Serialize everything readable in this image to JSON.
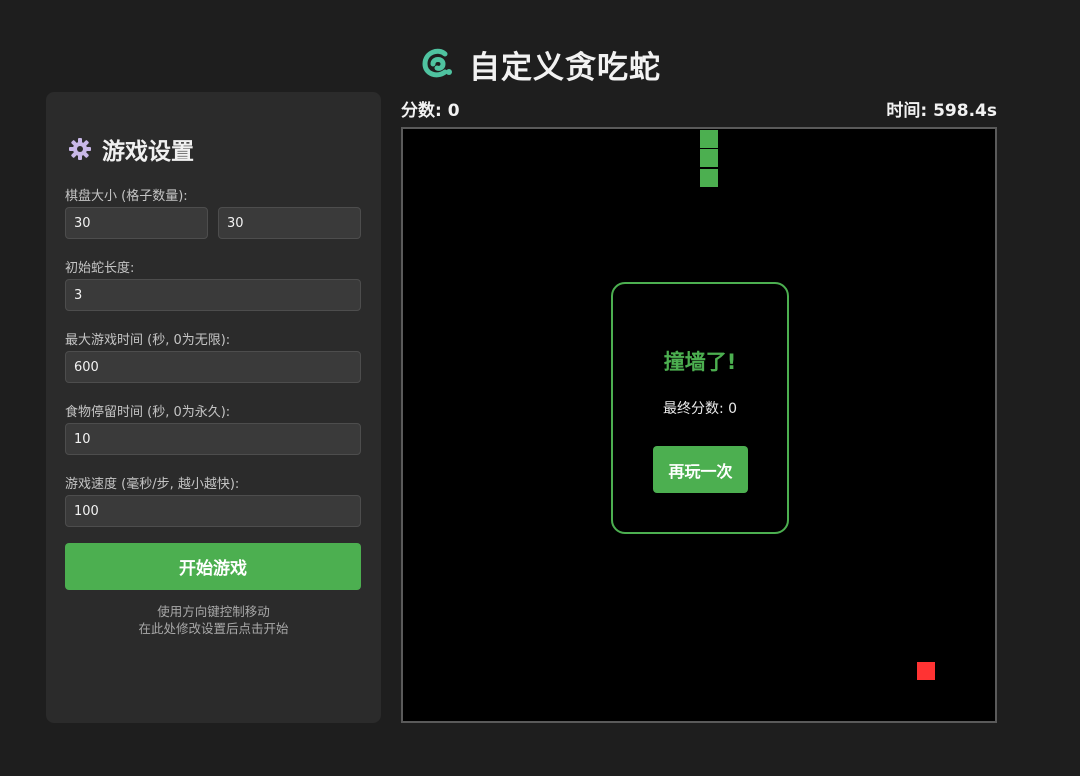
{
  "app": {
    "title": "自定义贪吃蛇",
    "logo_icon": "snake-icon",
    "accent_color": "#4caf50",
    "food_color": "#ff3333"
  },
  "settings": {
    "title": "游戏设置",
    "title_icon": "gear-icon",
    "board_size_label": "棋盘大小 (格子数量):",
    "board_width": "30",
    "board_height": "30",
    "initial_length_label": "初始蛇长度:",
    "initial_length": "3",
    "max_time_label": "最大游戏时间 (秒, 0为无限):",
    "max_time": "600",
    "food_duration_label": "食物停留时间 (秒, 0为永久):",
    "food_duration": "10",
    "speed_label": "游戏速度 (毫秒/步, 越小越快):",
    "speed": "100",
    "start_button": "开始游戏",
    "hint_line1": "使用方向键控制移动",
    "hint_line2": "在此处修改设置后点击开始"
  },
  "status": {
    "score_text": "分数: 0",
    "time_text": "时间: 598.4s"
  },
  "game": {
    "grid_cols": 30,
    "grid_rows": 30,
    "snake_cells": [
      [
        15,
        0
      ],
      [
        15,
        1
      ],
      [
        15,
        2
      ]
    ],
    "food_cell": [
      26,
      27
    ]
  },
  "game_over": {
    "title": "撞墙了!",
    "final_score_text": "最终分数: 0",
    "retry_button": "再玩一次"
  }
}
